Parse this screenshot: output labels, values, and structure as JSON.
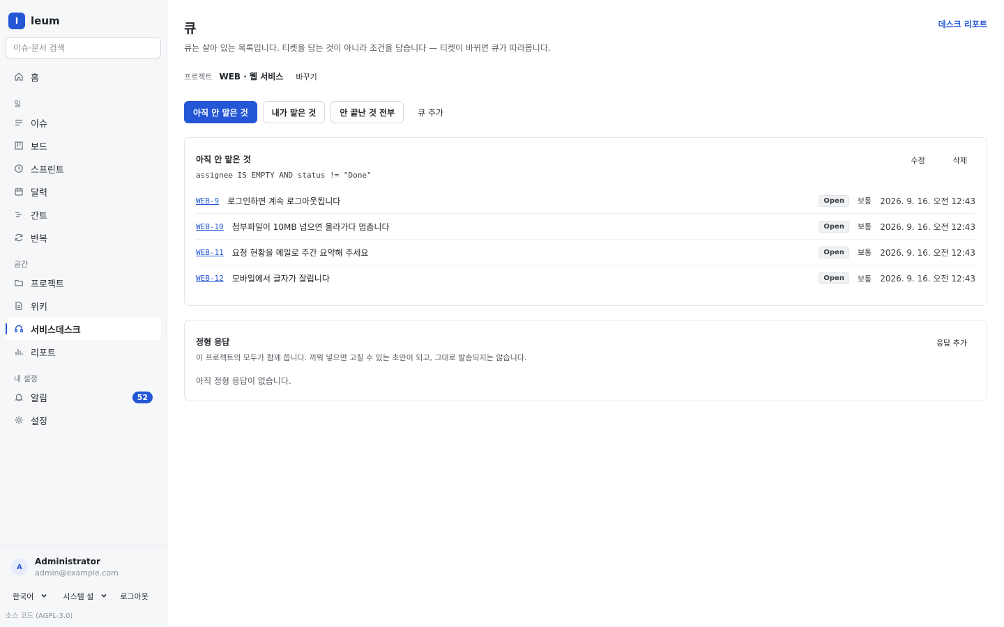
{
  "brand": {
    "logo": "I",
    "name": "leum"
  },
  "search": {
    "placeholder": "이슈·문서 검색"
  },
  "nav": {
    "home": "홈",
    "section_work": "일",
    "issues": "이슈",
    "board": "보드",
    "sprint": "스프린트",
    "calendar": "달력",
    "gantt": "간트",
    "recurring": "반복",
    "section_space": "공간",
    "projects": "프로젝트",
    "wiki": "위키",
    "servicedesk": "서비스데스크",
    "reports": "리포트",
    "section_mine": "내 설정",
    "notifications": "알림",
    "notifications_count": "52",
    "settings": "설정"
  },
  "user": {
    "avatar": "A",
    "name": "Administrator",
    "email": "admin@example.com"
  },
  "bottom": {
    "language": "한국어",
    "system": "시스템 설",
    "logout": "로그아웃",
    "source": "소스 코드 (AGPL-3.0)"
  },
  "page": {
    "title": "큐",
    "desk_report": "데스크 리포트",
    "subtitle": "큐는 살아 있는 목록입니다. 티켓을 담는 것이 아니라 조건을 담습니다 — 티켓이 바뀌면 큐가 따라옵니다.",
    "project_label": "프로젝트",
    "project_name": "WEB · 웹 서비스",
    "change": "바꾸기"
  },
  "tabs": {
    "unassigned": "아직 안 맡은 것",
    "mine": "내가 맡은 것",
    "all_open": "안 끝난 것 전부",
    "add": "큐 추가"
  },
  "queue": {
    "title": "아직 안 맡은 것",
    "edit": "수정",
    "delete": "삭제",
    "query": "assignee IS EMPTY AND status != \"Done\"",
    "rows": [
      {
        "key": "WEB-9",
        "summary": "로그인하면 계속 로그아웃됩니다",
        "status": "Open",
        "priority": "보통",
        "date": "2026. 9. 16. 오전 12:43"
      },
      {
        "key": "WEB-10",
        "summary": "첨부파일이 10MB 넘으면 올라가다 멈춥니다",
        "status": "Open",
        "priority": "보통",
        "date": "2026. 9. 16. 오전 12:43"
      },
      {
        "key": "WEB-11",
        "summary": "요청 현황을 메일로 주간 요약해 주세요",
        "status": "Open",
        "priority": "보통",
        "date": "2026. 9. 16. 오전 12:43"
      },
      {
        "key": "WEB-12",
        "summary": "모바일에서 글자가 잘립니다",
        "status": "Open",
        "priority": "보통",
        "date": "2026. 9. 16. 오전 12:43"
      }
    ]
  },
  "canned": {
    "title": "정형 응답",
    "add": "응답 추가",
    "description": "이 프로젝트의 모두가 함께 씁니다. 끼워 넣으면 고칠 수 있는 초안이 되고, 그대로 발송되지는 않습니다.",
    "empty": "아직 정형 응답이 없습니다."
  },
  "icons": {
    "home": "home-icon",
    "issues": "list-icon",
    "board": "board-icon",
    "sprint": "clock-icon",
    "calendar": "calendar-icon",
    "gantt": "gantt-icon",
    "recurring": "refresh-icon",
    "projects": "folder-icon",
    "wiki": "document-icon",
    "servicedesk": "headset-icon",
    "reports": "bar-chart-icon",
    "notifications": "bell-icon",
    "settings": "gear-icon"
  },
  "colors": {
    "accent": "#2457d6"
  }
}
